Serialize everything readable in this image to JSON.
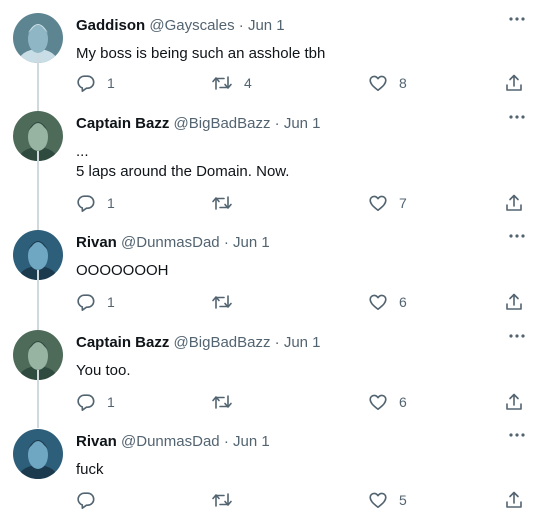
{
  "tweets": [
    {
      "name": "Gaddison",
      "handle": "@Gayscales",
      "sep": "·",
      "date": "Jun 1",
      "text": "My boss is being such an asshole tbh",
      "replies": "1",
      "retweets": "4",
      "likes": "8",
      "avatar": {
        "bg": "#5d8591",
        "face": "#c8dde6",
        "accent": "#8fb6c4"
      }
    },
    {
      "name": "Captain Bazz",
      "handle": "@BigBadBazz",
      "sep": "·",
      "date": "Jun 1",
      "text": "...\n5 laps around the Domain. Now.",
      "replies": "1",
      "retweets": "",
      "likes": "7",
      "avatar": {
        "bg": "#4e6b5a",
        "face": "#2f4a3f",
        "accent": "#97b3a1"
      }
    },
    {
      "name": "Rivan",
      "handle": "@DunmasDad",
      "sep": "·",
      "date": "Jun 1",
      "text": "OOOOOOOH",
      "replies": "1",
      "retweets": "",
      "likes": "6",
      "avatar": {
        "bg": "#2d5e7a",
        "face": "#1c3a4d",
        "accent": "#6fa7c2"
      }
    },
    {
      "name": "Captain Bazz",
      "handle": "@BigBadBazz",
      "sep": "·",
      "date": "Jun 1",
      "text": "You too.",
      "replies": "1",
      "retweets": "",
      "likes": "6",
      "avatar": {
        "bg": "#4e6b5a",
        "face": "#2f4a3f",
        "accent": "#97b3a1"
      }
    },
    {
      "name": "Rivan",
      "handle": "@DunmasDad",
      "sep": "·",
      "date": "Jun 1",
      "text": "fuck",
      "replies": "",
      "retweets": "",
      "likes": "5",
      "avatar": {
        "bg": "#2d5e7a",
        "face": "#1c3a4d",
        "accent": "#6fa7c2"
      }
    }
  ],
  "icons": {
    "more": "more-icon",
    "reply": "reply-icon",
    "retweet": "retweet-icon",
    "like": "like-icon",
    "share": "share-icon"
  },
  "colors": {
    "text": "#0f1419",
    "muted": "#536471",
    "thread_line": "#cfd9de"
  }
}
